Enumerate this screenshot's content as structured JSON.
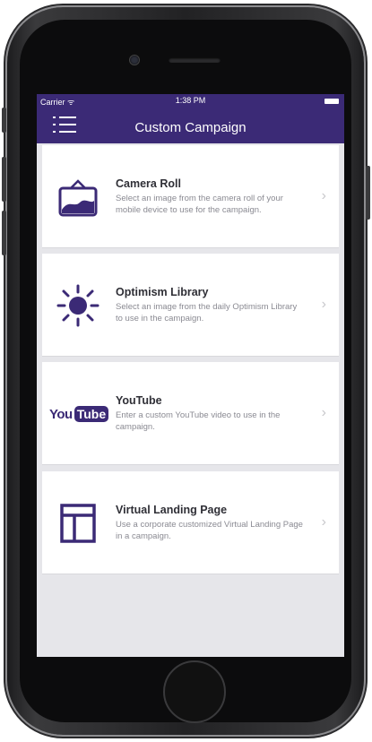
{
  "status_bar": {
    "carrier": "Carrier ᯤ",
    "time": "1:38 PM"
  },
  "header": {
    "title": "Custom Campaign"
  },
  "options": [
    {
      "title": "Camera Roll",
      "description": "Select an image from the camera roll of your mobile device to use for the campaign.",
      "icon": "camera-roll-icon"
    },
    {
      "title": "Optimism Library",
      "description": "Select an image from the daily Optimism Library to use in the campaign.",
      "icon": "sun-icon"
    },
    {
      "title": "YouTube",
      "description": "Enter a custom YouTube video to use in the campaign.",
      "icon": "youtube-logo",
      "logo_text": [
        "You",
        "Tube"
      ]
    },
    {
      "title": "Virtual Landing Page",
      "description": "Use a corporate customized Virtual Landing Page in a campaign.",
      "icon": "landing-page-icon"
    }
  ],
  "colors": {
    "navbar": "#3b2a76",
    "icon": "#3b2a76",
    "background": "#e6e6ea"
  }
}
